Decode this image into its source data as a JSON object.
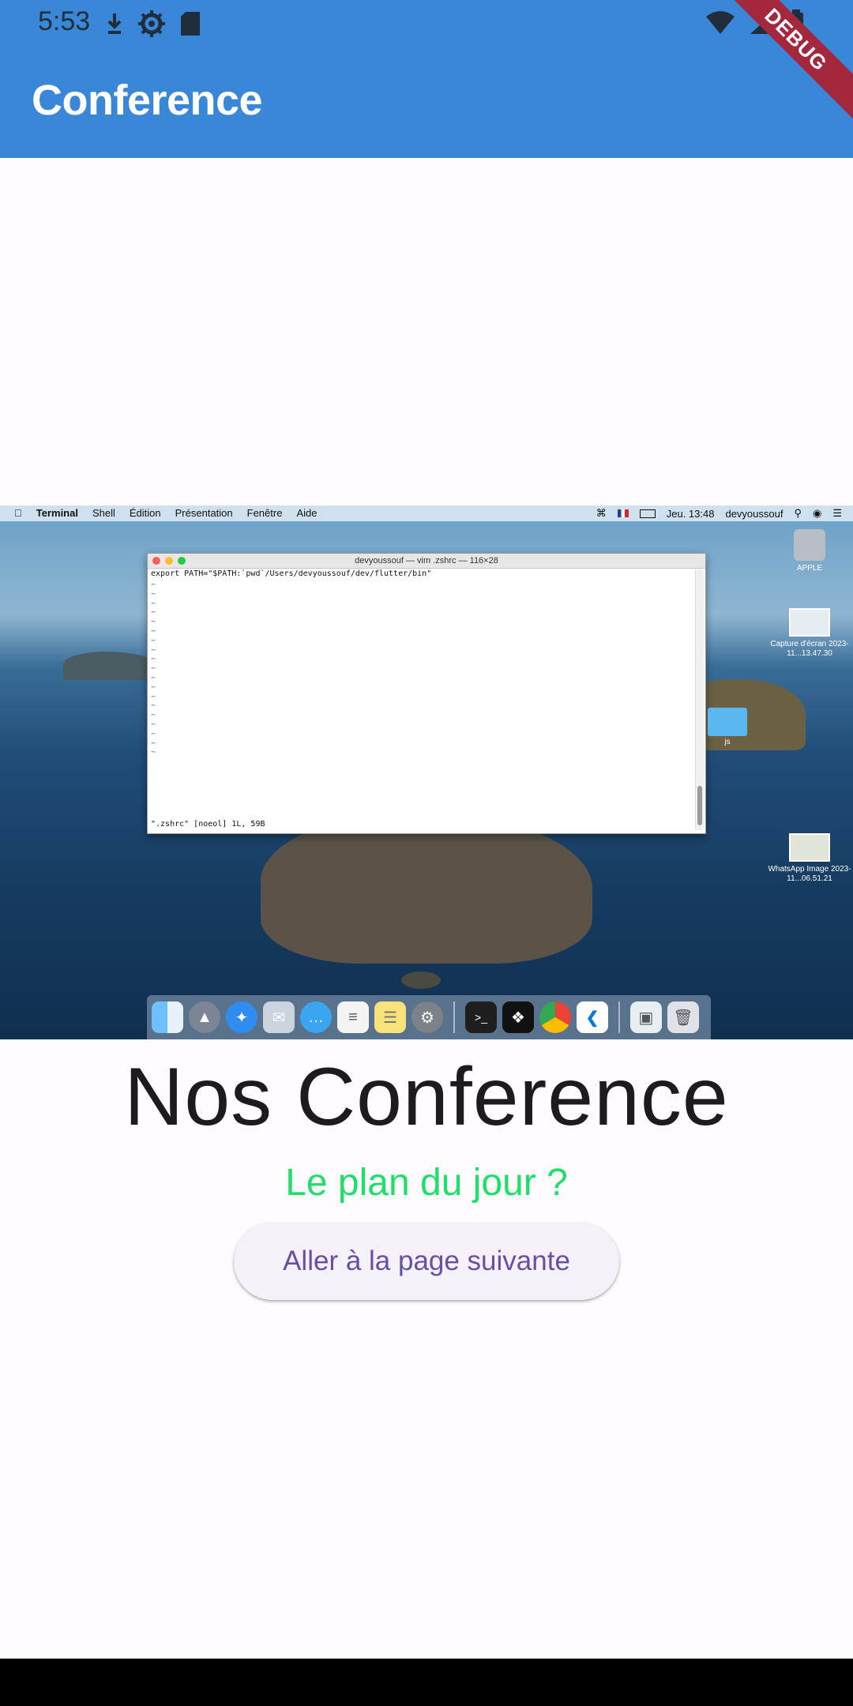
{
  "status_bar": {
    "time": "5:53",
    "icons_left": [
      "download-icon",
      "settings-icon",
      "sd-card-icon"
    ],
    "icons_right": [
      "wifi-icon",
      "signal-icon",
      "battery-icon"
    ]
  },
  "app_bar": {
    "title": "Conference",
    "debug_label": "DEBUG"
  },
  "embedded_screenshot": {
    "menubar": {
      "app": "Terminal",
      "items": [
        "Shell",
        "Édition",
        "Présentation",
        "Fenêtre",
        "Aide"
      ],
      "datetime": "Jeu. 13:48",
      "user": "devyoussouf"
    },
    "terminal": {
      "title": "devyoussouf — vim .zshrc — 116×28",
      "line1": "export PATH=\"$PATH:`pwd`/Users/devyoussouf/dev/flutter/bin\"",
      "tildes": "~\n~\n~\n~\n~\n~\n~\n~\n~\n~\n~\n~\n~\n~\n~\n~\n~\n~\n~",
      "status": "\".zshrc\" [noeol] 1L, 59B"
    },
    "desktop_icons": [
      {
        "label": "APPLE"
      },
      {
        "label": "Capture d'écran 2023-11...13.47.30"
      },
      {
        "label": "js"
      },
      {
        "label": "WhatsApp Image 2023-11...06.51.21"
      }
    ],
    "dock_apps": [
      "finder",
      "launchpad",
      "safari",
      "mail",
      "messages",
      "reminders",
      "notes",
      "system-preferences",
      "terminal",
      "figma",
      "chrome",
      "vscode",
      "preview",
      "trash"
    ]
  },
  "content": {
    "heading": "Nos Conference",
    "subheading": "Le plan du jour ?",
    "button_label": "Aller à la page suivante"
  },
  "colors": {
    "app_bar": "#3a87d8",
    "subheading": "#1fdf6a",
    "button_text": "#6750a4",
    "debug_banner": "#a3283d"
  }
}
